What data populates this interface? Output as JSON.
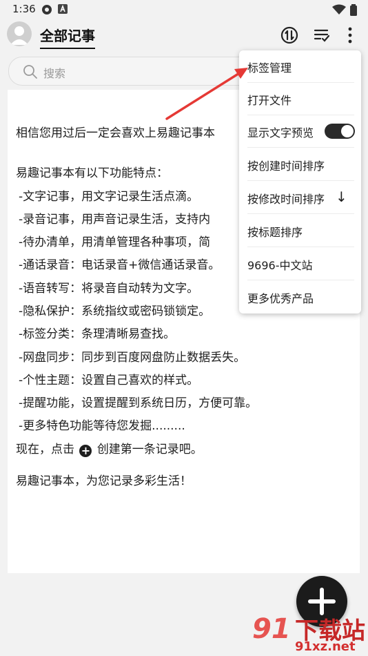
{
  "status_bar": {
    "time": "1:36"
  },
  "header": {
    "title": "全部记事"
  },
  "search": {
    "placeholder": "搜索"
  },
  "note": {
    "lines": [
      "相信您用过后一定会喜欢上易趣记事本",
      "易趣记事本有以下功能特点：",
      "-文字记事，用文字记录生活点滴。",
      "-录音记事，用声音记录生活，支持内",
      "-待办清单，用清单管理各种事项，简",
      "-通话录音：电话录音+微信通话录音。",
      "-语音转写：将录音自动转为文字。",
      "-隐私保护：系统指纹或密码锁锁定。",
      "-标签分类：条理清晰易查找。",
      "-网盘同步：同步到百度网盘防止数据丢失。",
      "-个性主题：设置自己喜欢的样式。",
      "-提醒功能，设置提醒到系统日历，方便可靠。",
      "-更多特色功能等待您发掘.........",
      "易趣记事本，为您记录多彩生活！"
    ],
    "create_prefix": "现在，点击",
    "create_suffix": "创建第一条记录吧。"
  },
  "menu": {
    "items": [
      {
        "label": "标签管理"
      },
      {
        "label": "打开文件"
      },
      {
        "label": "显示文字预览",
        "toggle_on": true
      },
      {
        "label": "按创建时间排序"
      },
      {
        "label": "按修改时间排序",
        "arrow": "↓"
      },
      {
        "label": "按标题排序"
      },
      {
        "label": "9696-中文站"
      },
      {
        "label": "更多优秀产品"
      }
    ]
  },
  "watermark": {
    "brand": "下载站",
    "domain": "91xz.net",
    "digits": "91"
  },
  "colors": {
    "accent": "#1b1b1b",
    "annotation": "#e53935"
  }
}
